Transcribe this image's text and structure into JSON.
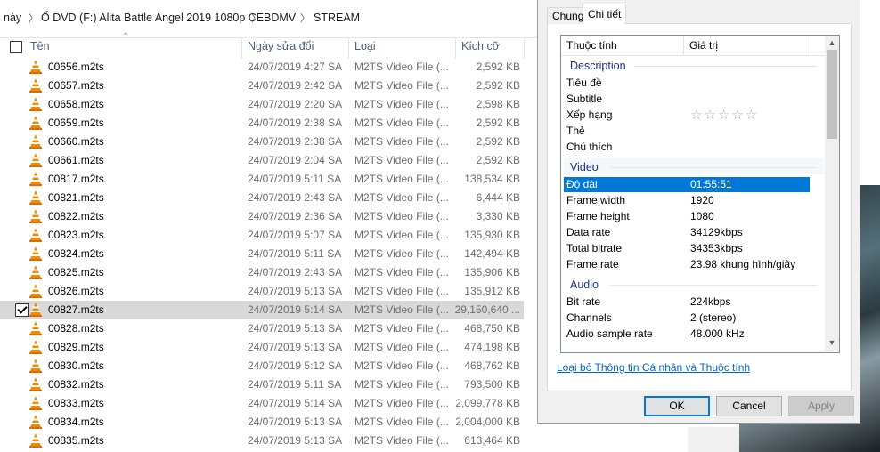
{
  "breadcrumb": {
    "items": [
      "này",
      "Ổ DVD (F:) Alita Battle Angel 2019 1080p CE",
      "BDMV",
      "STREAM"
    ]
  },
  "columns": {
    "name": "Tên",
    "date": "Ngày sửa đổi",
    "type": "Loại",
    "size": "Kích cỡ"
  },
  "files": [
    {
      "name": "00656.m2ts",
      "date": "24/07/2019 4:27 SA",
      "type": "M2TS Video File (...",
      "size": "2,592 KB"
    },
    {
      "name": "00657.m2ts",
      "date": "24/07/2019 2:42 SA",
      "type": "M2TS Video File (...",
      "size": "2,592 KB"
    },
    {
      "name": "00658.m2ts",
      "date": "24/07/2019 2:20 SA",
      "type": "M2TS Video File (...",
      "size": "2,598 KB"
    },
    {
      "name": "00659.m2ts",
      "date": "24/07/2019 2:38 SA",
      "type": "M2TS Video File (...",
      "size": "2,592 KB"
    },
    {
      "name": "00660.m2ts",
      "date": "24/07/2019 2:38 SA",
      "type": "M2TS Video File (...",
      "size": "2,592 KB"
    },
    {
      "name": "00661.m2ts",
      "date": "24/07/2019 2:04 SA",
      "type": "M2TS Video File (...",
      "size": "2,592 KB"
    },
    {
      "name": "00817.m2ts",
      "date": "24/07/2019 5:11 SA",
      "type": "M2TS Video File (...",
      "size": "138,534 KB"
    },
    {
      "name": "00821.m2ts",
      "date": "24/07/2019 2:43 SA",
      "type": "M2TS Video File (...",
      "size": "6,444 KB"
    },
    {
      "name": "00822.m2ts",
      "date": "24/07/2019 2:36 SA",
      "type": "M2TS Video File (...",
      "size": "3,330 KB"
    },
    {
      "name": "00823.m2ts",
      "date": "24/07/2019 5:07 SA",
      "type": "M2TS Video File (...",
      "size": "135,930 KB"
    },
    {
      "name": "00824.m2ts",
      "date": "24/07/2019 5:11 SA",
      "type": "M2TS Video File (...",
      "size": "142,494 KB"
    },
    {
      "name": "00825.m2ts",
      "date": "24/07/2019 2:43 SA",
      "type": "M2TS Video File (...",
      "size": "135,906 KB"
    },
    {
      "name": "00826.m2ts",
      "date": "24/07/2019 5:13 SA",
      "type": "M2TS Video File (...",
      "size": "135,912 KB"
    },
    {
      "name": "00827.m2ts",
      "date": "24/07/2019 5:14 SA",
      "type": "M2TS Video File (...",
      "size": "29,150,640 ...",
      "selected": true
    },
    {
      "name": "00828.m2ts",
      "date": "24/07/2019 5:13 SA",
      "type": "M2TS Video File (...",
      "size": "468,750 KB"
    },
    {
      "name": "00829.m2ts",
      "date": "24/07/2019 5:13 SA",
      "type": "M2TS Video File (...",
      "size": "474,198 KB"
    },
    {
      "name": "00830.m2ts",
      "date": "24/07/2019 5:12 SA",
      "type": "M2TS Video File (...",
      "size": "468,762 KB"
    },
    {
      "name": "00832.m2ts",
      "date": "24/07/2019 5:11 SA",
      "type": "M2TS Video File (...",
      "size": "793,500 KB"
    },
    {
      "name": "00833.m2ts",
      "date": "24/07/2019 5:14 SA",
      "type": "M2TS Video File (...",
      "size": "2,099,778 KB"
    },
    {
      "name": "00834.m2ts",
      "date": "24/07/2019 5:13 SA",
      "type": "M2TS Video File (...",
      "size": "2,004,000 KB"
    },
    {
      "name": "00835.m2ts",
      "date": "24/07/2019 5:13 SA",
      "type": "M2TS Video File (...",
      "size": "613,464 KB"
    }
  ],
  "dialog": {
    "tabs": [
      "Chung",
      "Chi tiết"
    ],
    "active_tab": "Chi tiết",
    "list_headers": {
      "property": "Thuộc tính",
      "value": "Giá trị"
    },
    "groups": {
      "description": "Description",
      "video": "Video",
      "audio": "Audio"
    },
    "description_props": [
      {
        "key": "Tiêu đề",
        "value": ""
      },
      {
        "key": "Subtitle",
        "value": ""
      },
      {
        "key": "Xếp hạng",
        "value": "☆☆☆☆☆"
      },
      {
        "key": "Thẻ",
        "value": ""
      },
      {
        "key": "Chú thích",
        "value": ""
      }
    ],
    "video_props": [
      {
        "key": "Độ dài",
        "value": "01:55:51",
        "selected": true
      },
      {
        "key": "Frame width",
        "value": "1920"
      },
      {
        "key": "Frame height",
        "value": "1080"
      },
      {
        "key": "Data rate",
        "value": "34129kbps"
      },
      {
        "key": "Total bitrate",
        "value": "34353kbps"
      },
      {
        "key": "Frame rate",
        "value": "23.98 khung hình/giây"
      }
    ],
    "audio_props": [
      {
        "key": "Bit rate",
        "value": "224kbps"
      },
      {
        "key": "Channels",
        "value": "2 (stereo)"
      },
      {
        "key": "Audio sample rate",
        "value": "48.000 kHz"
      }
    ],
    "remove_link": "Loại bỏ Thông tin Cá nhân và Thuộc tính",
    "buttons": {
      "ok": "OK",
      "cancel": "Cancel",
      "apply": "Apply"
    }
  },
  "colors": {
    "accent": "#0078d7",
    "selection_row": "#d9d9d9",
    "vlc_orange": "#f08a00",
    "group_text": "#1e3287"
  },
  "icons": {
    "file_icon": "vlc-cone-icon"
  }
}
